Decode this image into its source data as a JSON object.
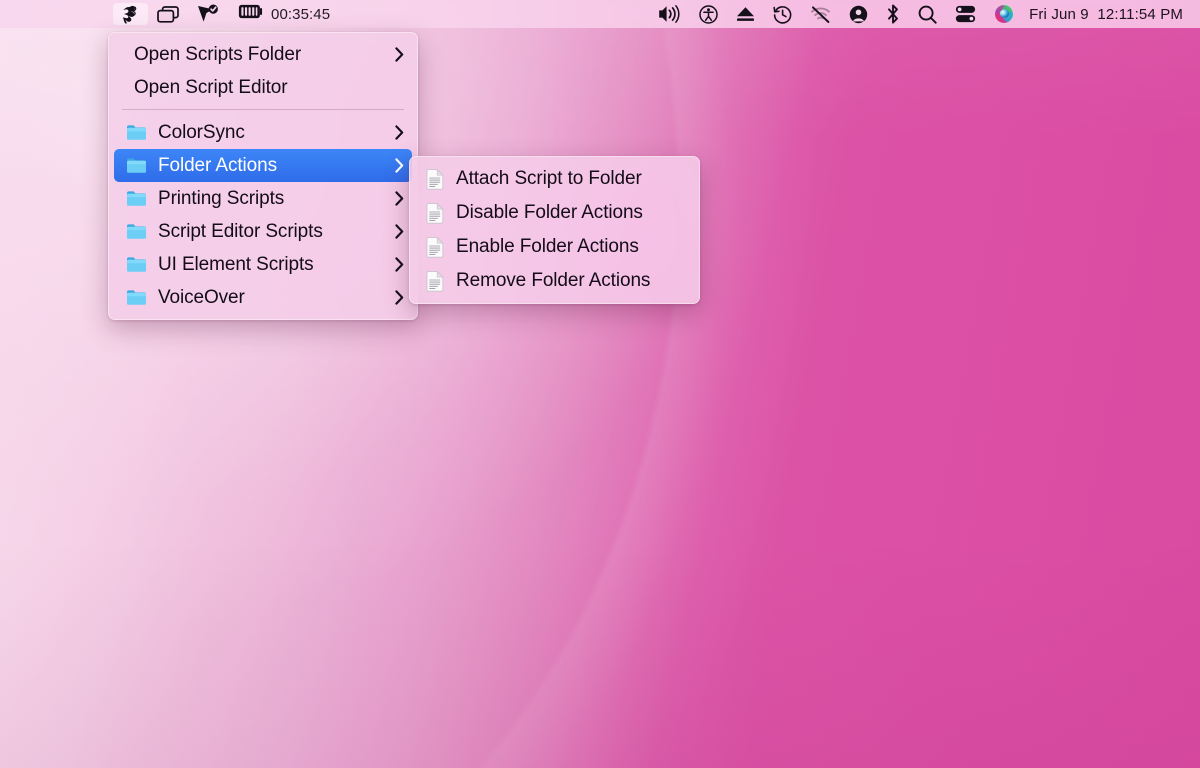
{
  "menubar": {
    "left_items": [
      {
        "name": "applescript-menu",
        "icon": "applescript-icon",
        "active": true
      },
      {
        "name": "mission-control-menu",
        "icon": "windows-stack-icon",
        "active": false
      },
      {
        "name": "shortcuts-menu",
        "icon": "cursor-check-icon",
        "active": false
      }
    ],
    "timer": {
      "icon": "timer-battery-icon",
      "value": "00:35:45"
    },
    "right_items": [
      {
        "name": "volume-menu",
        "icon": "speaker-waves-icon"
      },
      {
        "name": "accessibility-menu",
        "icon": "accessibility-icon"
      },
      {
        "name": "eject-menu",
        "icon": "eject-icon"
      },
      {
        "name": "time-machine-menu",
        "icon": "time-machine-icon"
      },
      {
        "name": "wifi-menu",
        "icon": "wifi-off-icon"
      },
      {
        "name": "user-account-menu",
        "icon": "user-circle-icon"
      },
      {
        "name": "bluetooth-menu",
        "icon": "bluetooth-icon"
      },
      {
        "name": "spotlight-menu",
        "icon": "search-icon"
      },
      {
        "name": "control-center-menu",
        "icon": "control-center-icon"
      },
      {
        "name": "siri-menu",
        "icon": "siri-orb-icon"
      }
    ],
    "clock": "Fri Jun 9  12:11:54 PM"
  },
  "main_menu": {
    "items": [
      {
        "label": "Open Scripts Folder",
        "icon": null,
        "submenu": true,
        "selected": false
      },
      {
        "label": "Open Script Editor",
        "icon": null,
        "submenu": false,
        "selected": false
      },
      {
        "separator": true
      },
      {
        "label": "ColorSync",
        "icon": "folder-icon",
        "submenu": true,
        "selected": false
      },
      {
        "label": "Folder Actions",
        "icon": "folder-icon",
        "submenu": true,
        "selected": true
      },
      {
        "label": "Printing Scripts",
        "icon": "folder-icon",
        "submenu": true,
        "selected": false
      },
      {
        "label": "Script Editor Scripts",
        "icon": "folder-icon",
        "submenu": true,
        "selected": false
      },
      {
        "label": "UI Element Scripts",
        "icon": "folder-icon",
        "submenu": true,
        "selected": false
      },
      {
        "label": "VoiceOver",
        "icon": "folder-icon",
        "submenu": true,
        "selected": false
      }
    ]
  },
  "submenu": {
    "parent": "Folder Actions",
    "items": [
      {
        "label": "Attach Script to Folder",
        "icon": "script-document-icon"
      },
      {
        "label": "Disable Folder Actions",
        "icon": "script-document-icon"
      },
      {
        "label": "Enable Folder Actions",
        "icon": "script-document-icon"
      },
      {
        "label": "Remove Folder Actions",
        "icon": "script-document-icon"
      }
    ]
  },
  "colors": {
    "highlight_blue": "#3d86f7",
    "menu_background": "#f3cee8",
    "menubar_background": "#f7d6ec",
    "wallpaper_dark_pink": "#db4ea4",
    "wallpaper_light_pink": "#f2cfe4",
    "folder_icon_blue": "#5ac8f5",
    "text_color": "#140c18"
  }
}
